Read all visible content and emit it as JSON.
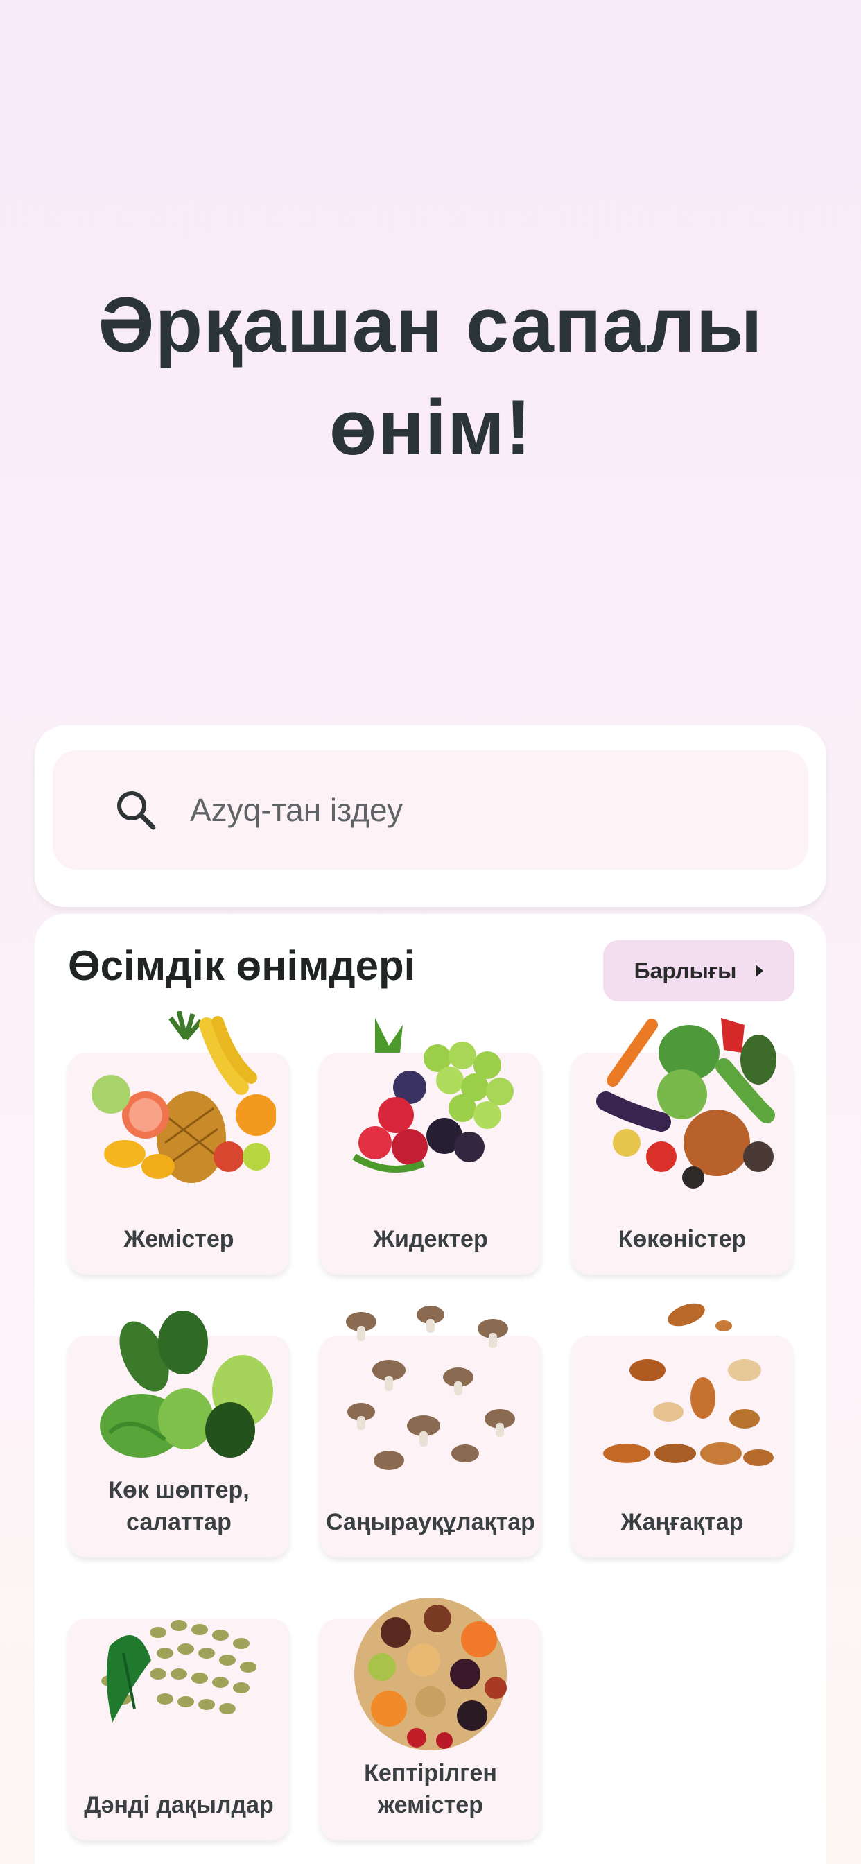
{
  "hero": {
    "line1": "Әрқашан сапалы",
    "line2": "өнім!"
  },
  "search": {
    "placeholder": "Azyq-тан іздеу",
    "icon": "search-icon"
  },
  "catalog": {
    "title": "Өсімдік өнімдері",
    "all_label": "Барлығы",
    "categories": [
      {
        "label": "Жемістер",
        "icon": "fruits-image"
      },
      {
        "label": "Жидектер",
        "icon": "berries-image"
      },
      {
        "label": "Көкөністер",
        "icon": "vegetables-image"
      },
      {
        "label": "Көк шөптер, салаттар",
        "icon": "greens-image"
      },
      {
        "label": "Саңырауқұлақтар",
        "icon": "mushrooms-image"
      },
      {
        "label": "Жаңғақтар",
        "icon": "nuts-image"
      },
      {
        "label": "Дәнді дақылдар",
        "icon": "grains-image"
      },
      {
        "label": "Кептірілген жемістер",
        "icon": "dried-fruits-image"
      }
    ]
  },
  "colors": {
    "accent": "#f3ddf0",
    "tile_bg": "#fdf2f6",
    "title": "#2b3537"
  }
}
